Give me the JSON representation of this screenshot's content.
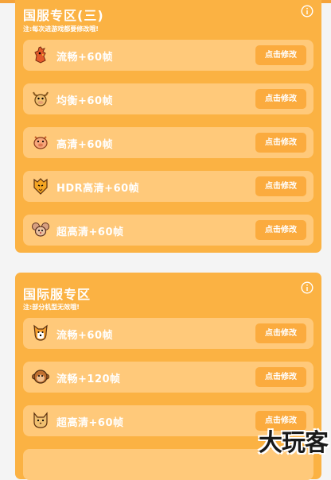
{
  "section_cn": {
    "title": "国服专区(三)",
    "note": "注:每次进游戏都要修改哦!",
    "items": [
      {
        "label": "流畅+60帧",
        "button": "点击修改",
        "icon": "rooster-icon"
      },
      {
        "label": "均衡+60帧",
        "button": "点击修改",
        "icon": "ox-icon"
      },
      {
        "label": "高清+60帧",
        "button": "点击修改",
        "icon": "pig-icon"
      },
      {
        "label": "HDR高清+60帧",
        "button": "点击修改",
        "icon": "tiger-icon"
      },
      {
        "label": "超高清+60帧",
        "button": "点击修改",
        "icon": "mouse-icon"
      }
    ]
  },
  "section_global": {
    "title": "国际服专区",
    "note": "注:部分机型无效哦!",
    "items": [
      {
        "label": "流畅+60帧",
        "button": "点击修改",
        "icon": "dog-icon"
      },
      {
        "label": "流畅+120帧",
        "button": "点击修改",
        "icon": "monkey-icon"
      },
      {
        "label": "超高清+60帧",
        "button": "点击修改",
        "icon": "cat-icon"
      }
    ]
  },
  "watermark": "大玩客",
  "colors": {
    "card": "#fbb243",
    "row": "#ffc97a",
    "button": "#fbab3e",
    "text": "#ffffff"
  }
}
